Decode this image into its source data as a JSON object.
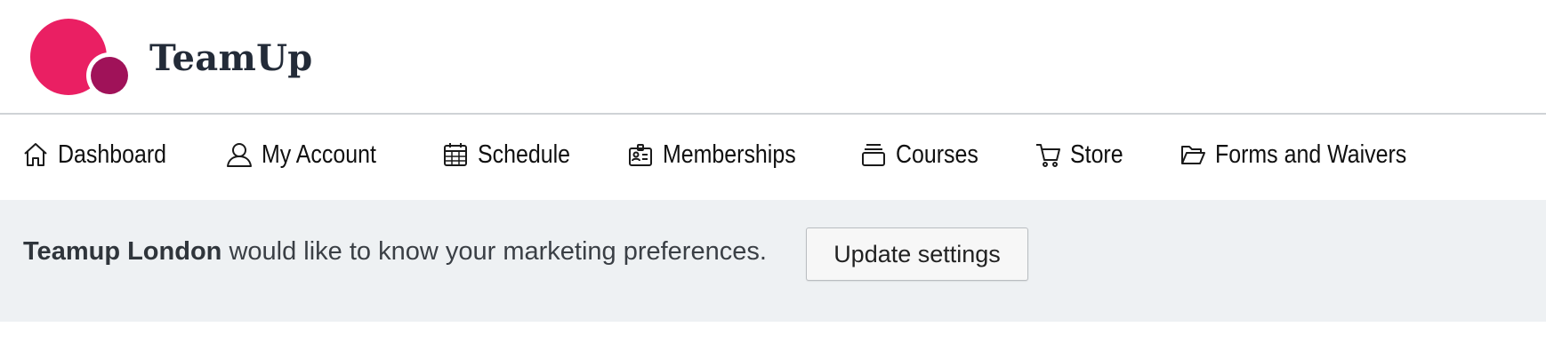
{
  "brand": {
    "name": "TeamUp",
    "colors": {
      "primary": "#ea1f63",
      "secondary": "#a01259"
    }
  },
  "nav": {
    "items": [
      {
        "label": "Dashboard",
        "icon": "home-icon"
      },
      {
        "label": "My Account",
        "icon": "user-icon"
      },
      {
        "label": "Schedule",
        "icon": "calendar-icon"
      },
      {
        "label": "Memberships",
        "icon": "id-card-icon"
      },
      {
        "label": "Courses",
        "icon": "stack-icon"
      },
      {
        "label": "Store",
        "icon": "cart-icon"
      },
      {
        "label": "Forms and Waivers",
        "icon": "folder-open-icon"
      }
    ]
  },
  "banner": {
    "org_name": "Teamup London",
    "message": " would like to know your marketing preferences.",
    "button_label": "Update settings"
  }
}
